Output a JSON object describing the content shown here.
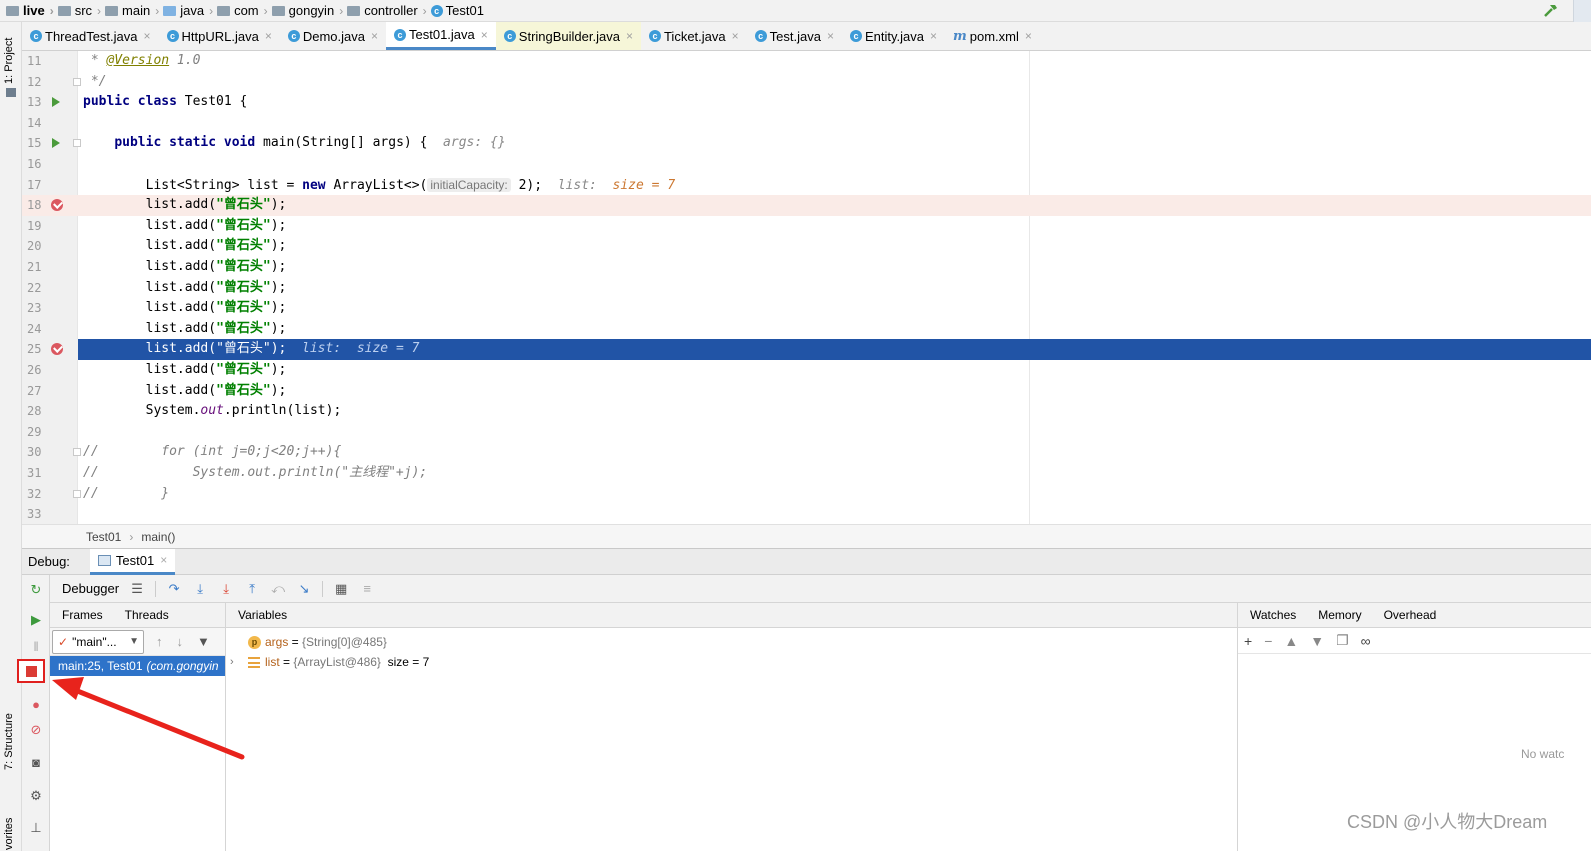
{
  "navbar": {
    "crumbs": [
      "live",
      "src",
      "main",
      "java",
      "com",
      "gongyin",
      "controller",
      "Test01"
    ]
  },
  "left_stripe": {
    "project_tab": "1: Project",
    "structure_tab": "7: Structure",
    "favorites_tab": "vorites"
  },
  "editor_tabs": [
    {
      "label": "ThreadTest.java",
      "icon": "class-icon"
    },
    {
      "label": "HttpURL.java",
      "icon": "class-icon"
    },
    {
      "label": "Demo.java",
      "icon": "class-icon"
    },
    {
      "label": "Test01.java",
      "icon": "class-icon",
      "active": true
    },
    {
      "label": "StringBuilder.java",
      "icon": "class-icon"
    },
    {
      "label": "Ticket.java",
      "icon": "class-icon"
    },
    {
      "label": "Test.java",
      "icon": "class-icon"
    },
    {
      "label": "Entity.java",
      "icon": "class-icon"
    },
    {
      "label": "pom.xml",
      "icon": "maven-icon"
    }
  ],
  "code": {
    "line_numbers": [
      "11",
      "12",
      "13",
      "14",
      "15",
      "16",
      "17",
      "18",
      "19",
      "20",
      "21",
      "22",
      "23",
      "24",
      "25",
      "26",
      "27",
      "28",
      "29",
      "30",
      "31",
      "32",
      "33"
    ],
    "l11_star": " * ",
    "l11_ann": "@Version",
    "l11_ver": " 1.0",
    "l12": " */",
    "l13_kw": "public class",
    "l13_rest": " Test01 {",
    "l15_indent": "    ",
    "l15_kw": "public static void",
    "l15_rest": " main(String[] args) {  ",
    "l15_hint": "args: {}",
    "l17_a": "        List<String> list = ",
    "l17_kw": "new",
    "l17_b": " ArrayList<>(",
    "l17_hint": "initialCapacity:",
    "l17_c": " 2);  ",
    "l17_hint2": "list:  ",
    "l17_val": "size = 7",
    "add_prefix": "        list.add(",
    "add_str": "\"曾石头\"",
    "add_suffix": ");",
    "l25_hint": "  list:  size = 7",
    "l28_a": "        System.",
    "l28_field": "out",
    "l28_b": ".println(list);",
    "l30": "//        for (int j=0;j<20;j++){",
    "l31": "//            System.out.println(\"主线程\"+j);",
    "l32": "//        }"
  },
  "breadcrumb_bar": {
    "class": "Test01",
    "method": "main()"
  },
  "debug": {
    "label": "Debug:",
    "session_tab": "Test01",
    "debugger_label": "Debugger",
    "frames_tab": "Frames",
    "threads_tab": "Threads",
    "thread_select": "\"main\"...",
    "frame_row": "main:25, Test01",
    "frame_pkg": "(com.gongyin",
    "variables_title": "Variables",
    "vars": [
      {
        "name": "args",
        "eq": " = ",
        "ref": "{String[0]@485}",
        "extra": ""
      },
      {
        "name": "list",
        "eq": " = ",
        "ref": "{ArrayList@486}",
        "extra": "  size = 7"
      }
    ],
    "watches_tab": "Watches",
    "memory_tab": "Memory",
    "overhead_tab": "Overhead",
    "no_watches": "No watc"
  },
  "watermark": "CSDN @小人物大Dream",
  "colors": {
    "current_line": "#2154a6",
    "breakpoint": "#db5860",
    "stop_highlight": "#e0201e",
    "arrow": "#e8231c"
  }
}
